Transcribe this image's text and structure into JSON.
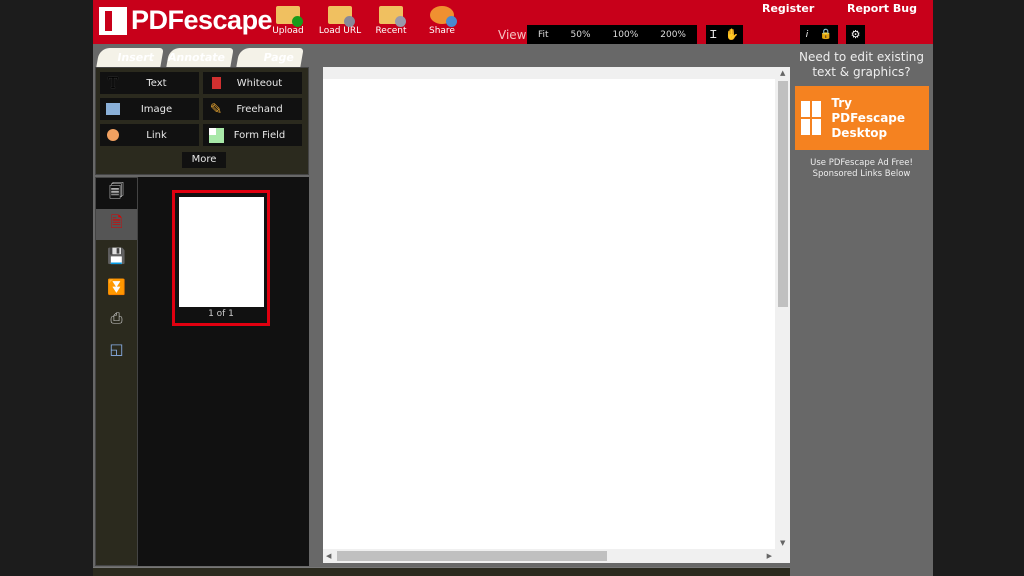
{
  "header": {
    "logo": "PDFescape",
    "toolbar": [
      {
        "label": "Upload",
        "icon": "upload-folder-icon"
      },
      {
        "label": "Load URL",
        "icon": "link-folder-icon"
      },
      {
        "label": "Recent",
        "icon": "recent-folder-icon"
      },
      {
        "label": "Share",
        "icon": "share-people-icon"
      }
    ],
    "view_label": "View",
    "zoom": [
      "Fit",
      "50%",
      "100%",
      "200%"
    ],
    "register": "Register",
    "report_bug": "Report Bug"
  },
  "tabs": [
    "Insert",
    "Annotate",
    "Page"
  ],
  "tools": [
    {
      "label": "Text",
      "icon": "text-icon"
    },
    {
      "label": "Whiteout",
      "icon": "whiteout-icon"
    },
    {
      "label": "Image",
      "icon": "image-icon"
    },
    {
      "label": "Freehand",
      "icon": "pencil-icon"
    },
    {
      "label": "Link",
      "icon": "link-icon"
    },
    {
      "label": "Form Field",
      "icon": "form-field-icon"
    }
  ],
  "more": "More",
  "thumbnail": {
    "caption": "1 of 1"
  },
  "ad": {
    "heading": "Need to edit existing text & graphics?",
    "button": "Try PDFescape Desktop",
    "note1": "Use PDFescape Ad Free!",
    "note2": "Sponsored Links Below"
  },
  "colors": {
    "brand": "#c8001a",
    "ad_orange": "#f58220"
  }
}
